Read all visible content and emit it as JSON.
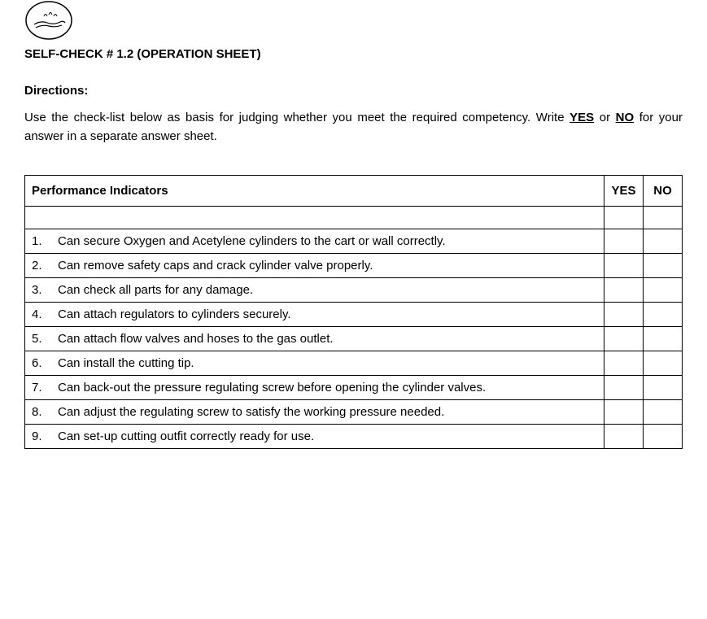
{
  "title": "SELF-CHECK # 1.2 (OPERATION SHEET)",
  "directions_label": "Directions:",
  "directions_text_pre": "Use the check-list below as basis for judging whether you meet the required competency. Write ",
  "yes_word": "YES",
  "directions_or": " or ",
  "no_word": "NO",
  "directions_text_post": " for your answer in a separate answer sheet.",
  "table": {
    "header_indicator": "Performance Indicators",
    "header_yes": "YES",
    "header_no": "NO",
    "rows": [
      {
        "num": "1.",
        "text": "Can secure Oxygen and Acetylene cylinders to the cart or wall correctly."
      },
      {
        "num": "2.",
        "text": "Can remove safety caps and crack cylinder valve properly."
      },
      {
        "num": "3.",
        "text": "Can check all parts for any damage."
      },
      {
        "num": "4.",
        "text": "Can attach regulators to cylinders securely."
      },
      {
        "num": "5.",
        "text": "Can attach flow valves and hoses to the gas outlet."
      },
      {
        "num": "6.",
        "text": "Can install the cutting tip."
      },
      {
        "num": "7.",
        "text": "Can back-out the pressure regulating screw before opening the cylinder valves."
      },
      {
        "num": "8.",
        "text": "Can adjust the regulating screw to satisfy the working pressure needed."
      },
      {
        "num": "9.",
        "text": "Can set-up cutting outfit correctly ready for use."
      }
    ]
  }
}
